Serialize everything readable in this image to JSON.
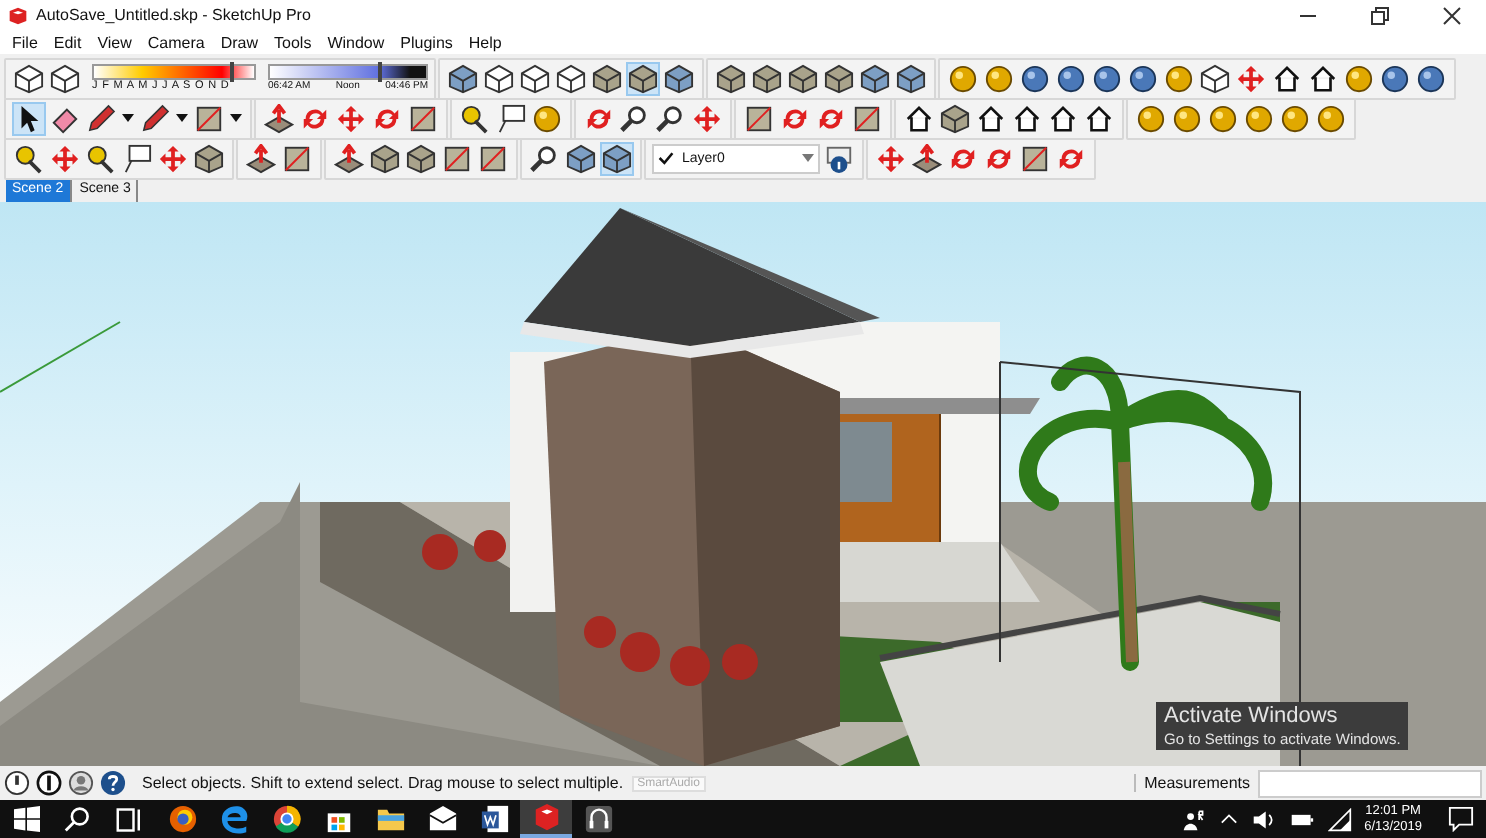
{
  "window": {
    "title": "AutoSave_Untitled.skp - SketchUp Pro"
  },
  "menu": [
    "File",
    "Edit",
    "View",
    "Camera",
    "Draw",
    "Tools",
    "Window",
    "Plugins",
    "Help"
  ],
  "shadow_settings": {
    "months": "J F M A M J J A S O N D",
    "date_slider": {
      "level": 0.85
    },
    "time_start": "06:42 AM",
    "time_mid": "Noon",
    "time_end": "04:46 PM",
    "time_slider": {
      "level": 0.69
    }
  },
  "toolbar_rows": [
    {
      "groups": [
        {
          "buttons": [
            {
              "selected": false
            },
            {
              "selected": false
            }
          ]
        },
        {
          "buttons": [
            {
              "selected": false
            },
            {
              "selected": false
            },
            {
              "selected": false
            },
            {
              "selected": false
            },
            {
              "selected": false
            },
            {
              "selected": true
            },
            {
              "selected": false
            }
          ]
        },
        {
          "buttons": [
            {
              "selected": false
            },
            {
              "selected": false
            },
            {
              "selected": false
            },
            {
              "selected": false
            },
            {
              "selected": false
            },
            {
              "selected": false
            }
          ]
        },
        {
          "buttons": [
            {
              "selected": false
            },
            {
              "selected": false
            },
            {
              "selected": false
            },
            {
              "selected": false
            },
            {
              "selected": false
            },
            {
              "selected": false
            },
            {
              "selected": false
            },
            {
              "selected": false
            },
            {
              "selected": false
            },
            {
              "selected": false
            },
            {
              "selected": false
            },
            {
              "selected": false
            },
            {
              "selected": false
            },
            {
              "selected": false
            }
          ]
        }
      ]
    },
    {
      "groups": [
        {
          "buttons": [
            {
              "selected": true
            },
            {
              "selected": false
            },
            {
              "selected": false,
              "dropdown": true
            },
            {
              "selected": false,
              "dropdown": true
            },
            {
              "selected": false,
              "dropdown": true
            }
          ]
        },
        {
          "buttons": [
            {
              "selected": false
            },
            {
              "selected": false
            },
            {
              "selected": false
            },
            {
              "selected": false
            },
            {
              "selected": false
            }
          ]
        },
        {
          "buttons": [
            {
              "selected": false
            },
            {
              "selected": false
            },
            {
              "selected": false
            }
          ]
        },
        {
          "buttons": [
            {
              "selected": false
            },
            {
              "selected": false
            },
            {
              "selected": false
            },
            {
              "selected": false
            }
          ]
        },
        {
          "buttons": [
            {
              "selected": false
            },
            {
              "selected": false
            },
            {
              "selected": false
            },
            {
              "selected": false
            }
          ]
        },
        {
          "buttons": [
            {
              "selected": false
            },
            {
              "selected": false
            },
            {
              "selected": false
            },
            {
              "selected": false
            },
            {
              "selected": false
            },
            {
              "selected": false
            }
          ]
        },
        {
          "buttons": [
            {
              "selected": false
            },
            {
              "selected": false
            },
            {
              "selected": false
            },
            {
              "selected": false
            },
            {
              "selected": false
            },
            {
              "selected": false
            }
          ]
        }
      ]
    },
    {
      "groups": [
        {
          "buttons": [
            {
              "selected": false
            },
            {
              "selected": false
            },
            {
              "selected": false
            },
            {
              "selected": false
            },
            {
              "selected": false
            },
            {
              "selected": false
            }
          ]
        },
        {
          "buttons": [
            {
              "selected": false
            },
            {
              "selected": false
            }
          ]
        },
        {
          "buttons": [
            {
              "selected": false
            },
            {
              "selected": false
            },
            {
              "selected": false
            },
            {
              "selected": false
            },
            {
              "selected": false
            }
          ]
        },
        {
          "buttons": [
            {
              "selected": false
            },
            {
              "selected": false
            },
            {
              "selected": true
            }
          ]
        },
        {
          "layer": {
            "value": "Layer0"
          }
        },
        {
          "buttons": [
            {
              "selected": false
            },
            {
              "selected": false
            },
            {
              "selected": false
            },
            {
              "selected": false
            },
            {
              "selected": false
            },
            {
              "selected": false
            }
          ]
        }
      ]
    }
  ],
  "scenes": [
    {
      "label": "Scene 2",
      "selected": true
    },
    {
      "label": "Scene 3",
      "selected": false
    }
  ],
  "os_notice": {
    "title": "Activate Windows",
    "text": "Go to Settings to activate Windows."
  },
  "status_bar": {
    "hint": "Select objects. Shift to extend select. Drag mouse to select multiple.",
    "tooltip": "SmartAudio",
    "measurements_label": "Measurements"
  },
  "taskbar": {
    "apps": [
      {
        "selected": false
      },
      {
        "selected": false
      },
      {
        "selected": false
      },
      {
        "selected": false
      },
      {
        "selected": false
      },
      {
        "selected": false
      },
      {
        "selected": false
      },
      {
        "selected": true
      },
      {
        "selected": false
      }
    ],
    "time": "12:01 PM",
    "date": "6/13/2019"
  }
}
